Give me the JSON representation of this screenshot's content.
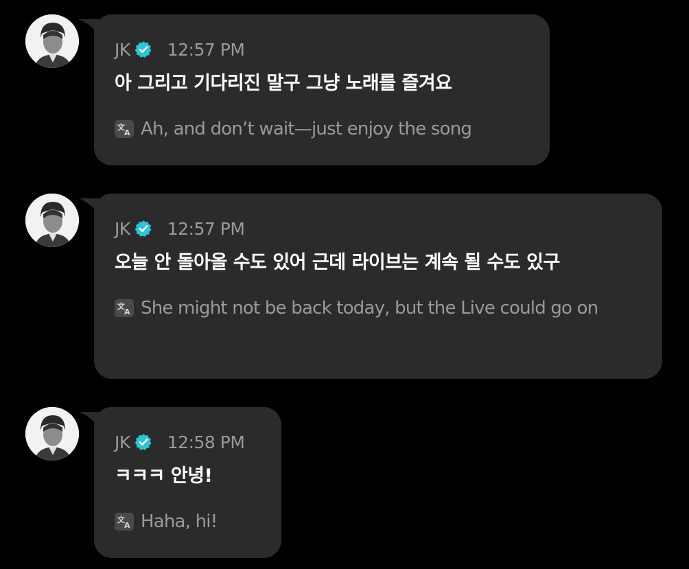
{
  "messages": [
    {
      "sender": "JK",
      "time": "12:57 PM",
      "text": "아 그리고 기다리진 말구 그냥 노래를 즐겨요",
      "translation": "Ah, and don’t wait—just enjoy the song"
    },
    {
      "sender": "JK",
      "time": "12:57 PM",
      "text": "오늘 안 돌아올 수도 있어 근데 라이브는 계속 될 수도 있구",
      "translation": "She might not be back today, but the Live could go on"
    },
    {
      "sender": "JK",
      "time": "12:58 PM",
      "text": "ㅋㅋㅋ 안녕!",
      "translation": "Haha, hi!"
    }
  ],
  "icons": {
    "verified": "verified-check-icon",
    "translate": "translate-icon"
  },
  "colors": {
    "background": "#000000",
    "bubble": "#2b2b2b",
    "verified": "#2ec4d6",
    "meta_text": "#9a9a9a",
    "message_text": "#ffffff"
  }
}
